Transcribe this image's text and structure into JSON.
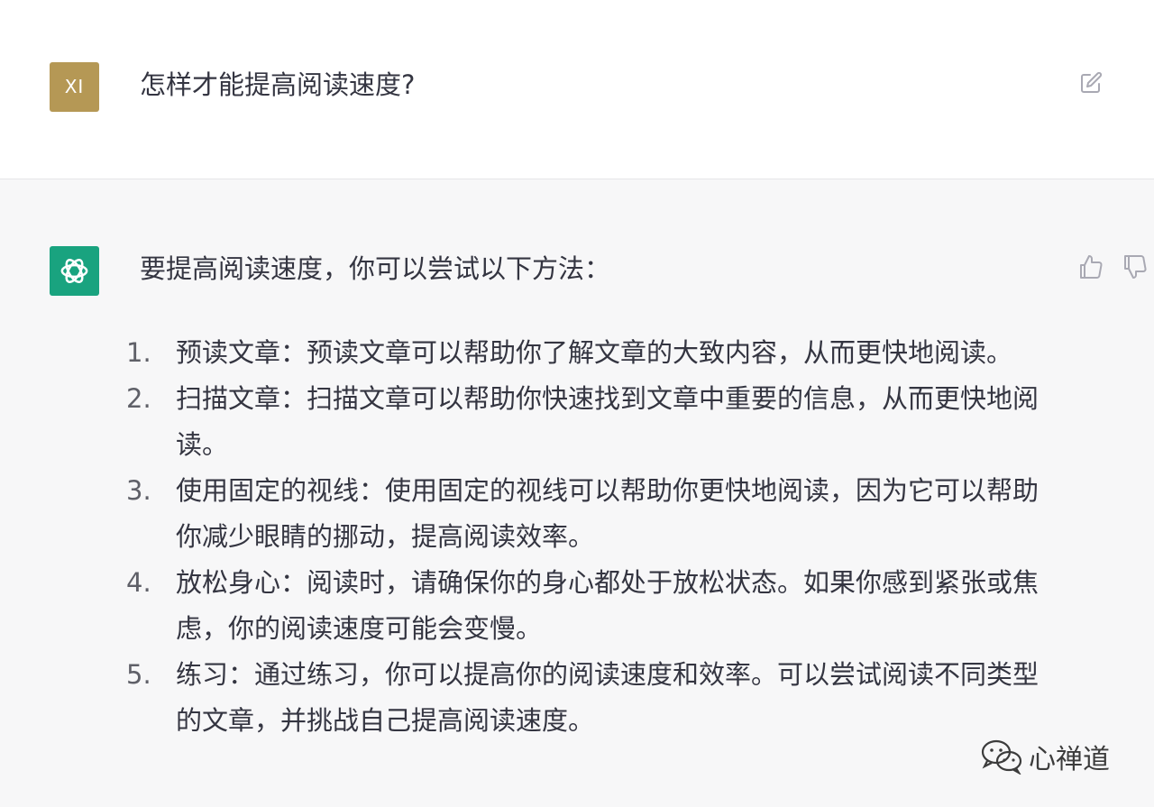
{
  "user": {
    "avatar_initials": "XI",
    "avatar_color": "#b59855",
    "question": "怎样才能提高阅读速度?"
  },
  "assistant": {
    "avatar_color": "#19a37f",
    "intro": "要提高阅读速度，你可以尝试以下方法：",
    "items": [
      {
        "number": "1.",
        "text": "预读文章：预读文章可以帮助你了解文章的大致内容，从而更快地阅读。"
      },
      {
        "number": "2.",
        "text": "扫描文章：扫描文章可以帮助你快速找到文章中重要的信息，从而更快地阅读。"
      },
      {
        "number": "3.",
        "text": "使用固定的视线：使用固定的视线可以帮助你更快地阅读，因为它可以帮助你减少眼睛的挪动，提高阅读效率。"
      },
      {
        "number": "4.",
        "text": "放松身心：阅读时，请确保你的身心都处于放松状态。如果你感到紧张或焦虑，你的阅读速度可能会变慢。"
      },
      {
        "number": "5.",
        "text": "练习：通过练习，你可以提高你的阅读速度和效率。可以尝试阅读不同类型的文章，并挑战自己提高阅读速度。"
      }
    ]
  },
  "watermark": {
    "text": "心禅道",
    "icon": "wechat-icon"
  },
  "icons": {
    "edit": "edit-icon",
    "thumbs_up": "thumbs-up-icon",
    "thumbs_down": "thumbs-down-icon",
    "assistant_logo": "openai-logo-icon"
  }
}
